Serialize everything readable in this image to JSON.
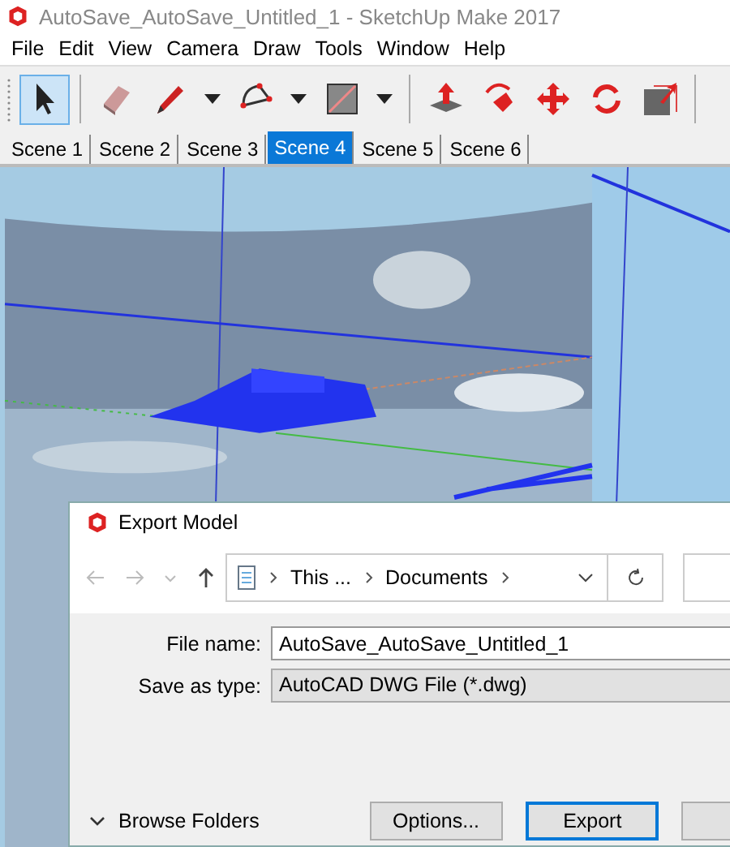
{
  "window": {
    "title": "AutoSave_AutoSave_Untitled_1 - SketchUp Make 2017"
  },
  "menu": [
    "File",
    "Edit",
    "View",
    "Camera",
    "Draw",
    "Tools",
    "Window",
    "Help"
  ],
  "toolbar": [
    {
      "selected": true,
      "dropdown": false
    },
    {
      "selected": false,
      "dropdown": false
    },
    {
      "selected": false,
      "dropdown": true
    },
    {
      "selected": false,
      "dropdown": true
    },
    {
      "selected": false,
      "dropdown": true
    },
    {
      "selected": false,
      "dropdown": false
    },
    {
      "selected": false,
      "dropdown": false
    },
    {
      "selected": false,
      "dropdown": false
    },
    {
      "selected": false,
      "dropdown": false
    },
    {
      "selected": false,
      "dropdown": false
    }
  ],
  "scenes": [
    {
      "label": "Scene 1",
      "selected": false
    },
    {
      "label": "Scene 2",
      "selected": false
    },
    {
      "label": "Scene 3",
      "selected": false
    },
    {
      "label": "Scene 4",
      "selected": true
    },
    {
      "label": "Scene 5",
      "selected": false
    },
    {
      "label": "Scene 6",
      "selected": false
    }
  ],
  "dialog": {
    "title": "Export Model",
    "breadcrumb": [
      "This ...",
      "Documents"
    ],
    "fields": [
      {
        "label": "File name:",
        "value": "AutoSave_AutoSave_Untitled_1",
        "kind": "input"
      },
      {
        "label": "Save as type:",
        "value": "AutoCAD DWG File (*.dwg)",
        "kind": "select"
      }
    ],
    "browse": "Browse Folders",
    "buttons": [
      {
        "label": "Options...",
        "default": false
      },
      {
        "label": "Export",
        "default": true
      }
    ]
  }
}
